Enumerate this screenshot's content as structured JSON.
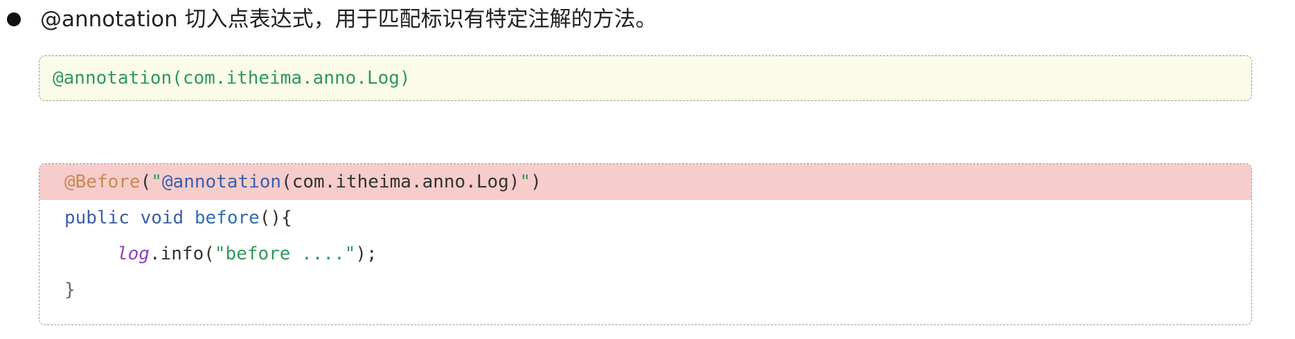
{
  "bullet": {
    "text": "@annotation 切入点表达式，用于匹配标识有特定注解的方法。"
  },
  "example_expression": {
    "code": "@annotation(com.itheima.anno.Log)"
  },
  "example_code": {
    "line1": {
      "annotation": "@Before",
      "open": "(",
      "q1": "\"",
      "inner_ann": "@annotation",
      "inner_rest": "(com.itheima.anno.Log)",
      "q2": "\"",
      "close": ")"
    },
    "line2": {
      "kw_public": "public",
      "kw_void": "void",
      "method": "before",
      "parens": "(){"
    },
    "line3": {
      "field": "log",
      "call": ".info(",
      "string": "\"before ....\"",
      "end": ");"
    },
    "line4": {
      "brace": "}"
    }
  }
}
